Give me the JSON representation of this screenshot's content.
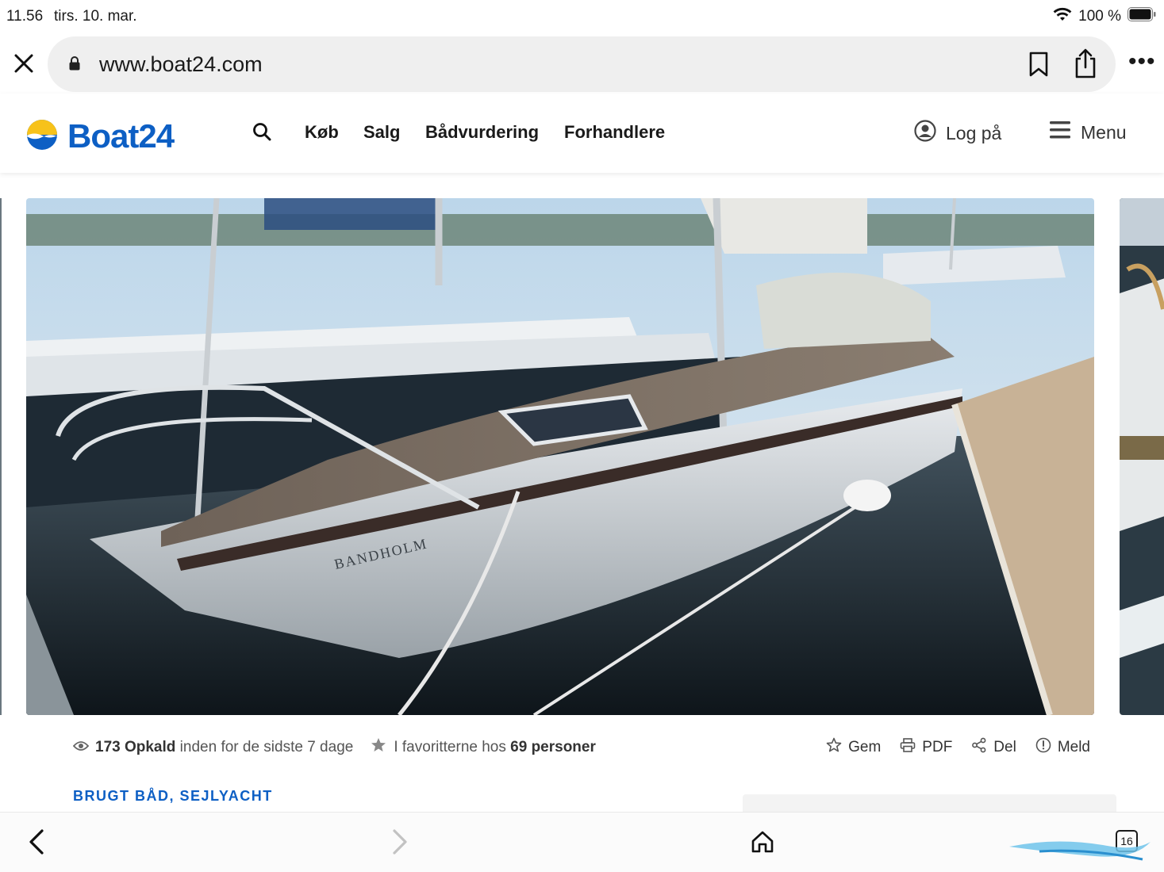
{
  "status_bar": {
    "time": "11.56",
    "date": "tirs. 10. mar.",
    "battery": "100 %"
  },
  "browser": {
    "url": "www.boat24.com",
    "tab_count": "16",
    "icons": [
      "close-icon",
      "lock-icon",
      "bookmark-icon",
      "share-icon",
      "more-icon",
      "back-icon",
      "forward-icon",
      "home-icon",
      "tabs-icon"
    ]
  },
  "header": {
    "logo_text": "Boat24",
    "nav": [
      "Køb",
      "Salg",
      "Bådvurdering",
      "Forhandlere"
    ],
    "login_label": "Log på",
    "menu_label": "Menu",
    "brand_color": "#0d5fc4",
    "logo_sun_color": "#f7c21a"
  },
  "listing": {
    "photo_caption": "BANDHOLM",
    "stats": {
      "views_count": "173",
      "views_label": "Opkald",
      "views_suffix": "inden for de sidste 7 dage",
      "fav_prefix": "I favoritterne hos",
      "fav_count": "69 personer"
    },
    "actions": {
      "save": "Gem",
      "pdf": "PDF",
      "share": "Del",
      "report": "Meld"
    },
    "category": "BRUGT BÅD, SEJLYACHT"
  }
}
